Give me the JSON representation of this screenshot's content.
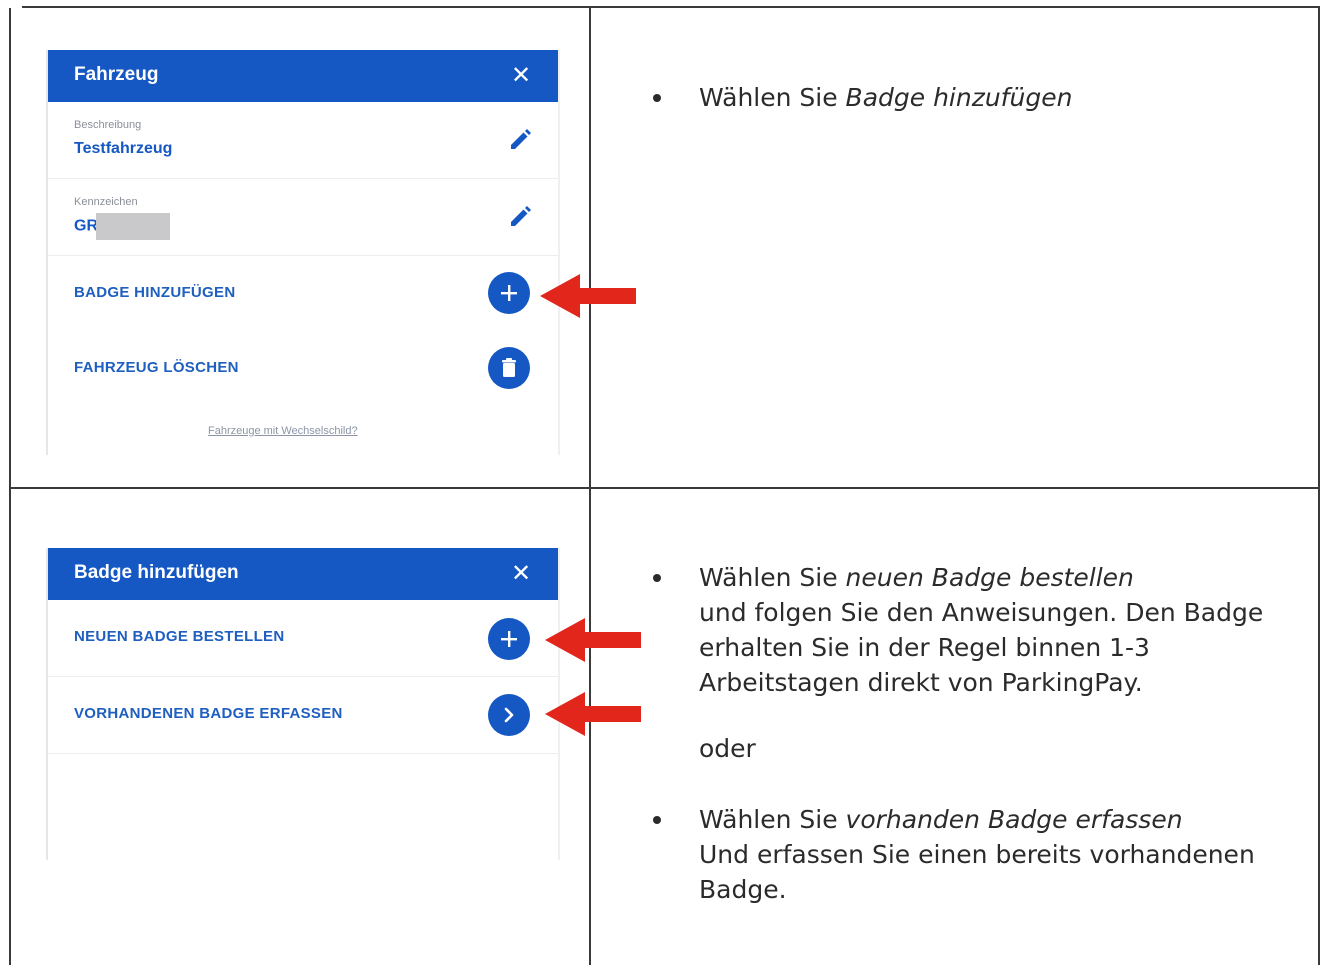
{
  "colors": {
    "accent": "#1558c4",
    "arrow": "#e3261b",
    "grid": "#3a3a3a"
  },
  "panel1": {
    "title": "Fahrzeug",
    "close_icon": "close-icon",
    "fields": [
      {
        "label": "Beschreibung",
        "value": "Testfahrzeug",
        "icon": "pencil-icon"
      },
      {
        "label": "Kennzeichen",
        "value": "GR",
        "icon": "pencil-icon"
      }
    ],
    "actions": [
      {
        "label": "BADGE HINZUFÜGEN",
        "icon": "plus-icon"
      },
      {
        "label": "FAHRZEUG LÖSCHEN",
        "icon": "trash-icon"
      }
    ],
    "footer_link": "Fahrzeuge mit Wechselschild?"
  },
  "panel2": {
    "title": "Badge hinzufügen",
    "close_icon": "close-icon",
    "actions": [
      {
        "label": "NEUEN BADGE BESTELLEN",
        "icon": "plus-icon"
      },
      {
        "label": "VORHANDENEN BADGE ERFASSEN",
        "icon": "chevron-right-icon"
      }
    ]
  },
  "instructions1": {
    "bullet1_prefix": "Wählen Sie ",
    "bullet1_emph": "Badge hinzufügen"
  },
  "instructions2": {
    "bullet1_prefix": "Wählen Sie ",
    "bullet1_emph": "neuen Badge bestellen",
    "bullet1_line2": "und folgen Sie den Anweisungen. Den Badge",
    "bullet1_line3": "erhalten Sie in der Regel binnen 1-3",
    "bullet1_line4": "Arbeitstagen direkt von ParkingPay.",
    "separator": "oder",
    "bullet2_prefix": "Wählen Sie ",
    "bullet2_emph": "vorhanden Badge erfassen",
    "bullet2_line2": "Und erfassen Sie einen bereits vorhandenen",
    "bullet2_line3": "Badge."
  }
}
